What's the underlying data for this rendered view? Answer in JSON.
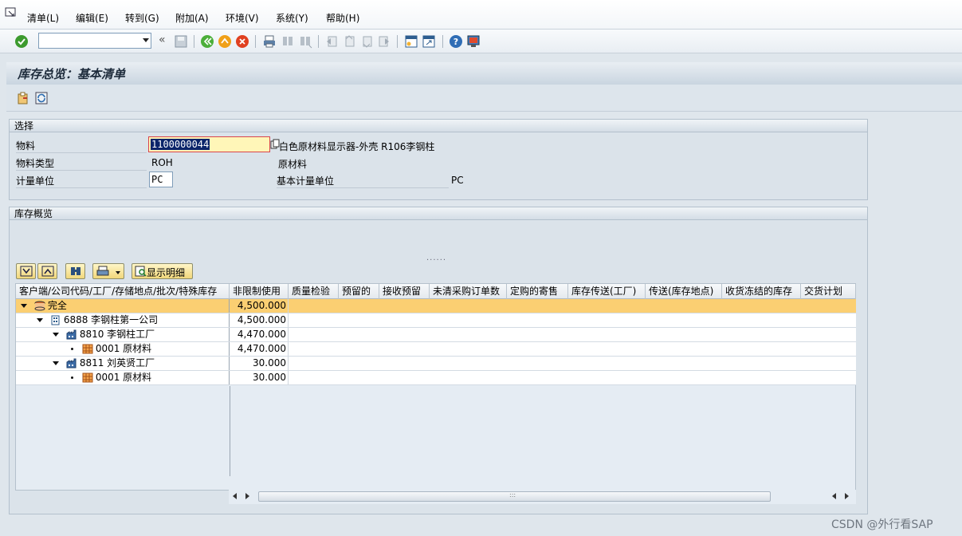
{
  "menu": {
    "items": [
      "清单(L)",
      "编辑(E)",
      "转到(G)",
      "附加(A)",
      "环境(V)",
      "系统(Y)",
      "帮助(H)"
    ]
  },
  "toolbar": {
    "command_field_value": "",
    "back_label": "«"
  },
  "page": {
    "title": "库存总览：基本清单"
  },
  "selection": {
    "group_title": "选择",
    "material_label": "物料",
    "material_value": "1100000044",
    "material_desc": "白色原材料显示器-外壳 R106李钢柱",
    "mattype_label": "物料类型",
    "mattype_value": "ROH",
    "mattype_desc": "原材料",
    "uom_label": "计量单位",
    "uom_value": "PC",
    "base_uom_label": "基本计量单位",
    "base_uom_value": "PC"
  },
  "overview": {
    "group_title": "库存概览",
    "splitter_dots": "......",
    "detail_button": "显示明细",
    "columns": [
      "客户端/公司代码/工厂/存储地点/批次/特殊库存",
      "非限制使用",
      "质量检验",
      "预留的",
      "接收预留",
      "未清采购订单数",
      "定购的寄售",
      "库存传送(工厂)",
      "传送(库存地点)",
      "收货冻结的库存",
      "交货计划"
    ],
    "rows": [
      {
        "label": "完全",
        "value": "4,500.000"
      },
      {
        "label": "6888 李钢柱第一公司",
        "value": "4,500.000"
      },
      {
        "label": "8810 李钢柱工厂",
        "value": "4,470.000"
      },
      {
        "label": "0001 原材料",
        "value": "4,470.000"
      },
      {
        "label": "8811 刘英贤工厂",
        "value": "30.000"
      },
      {
        "label": "0001 原材料",
        "value": "30.000"
      }
    ],
    "scroll_grip": ":::"
  },
  "watermark": "CSDN @外行看SAP",
  "colors": {
    "total_row": "#fbcf72",
    "background": "#dfe6ec",
    "focus_field": "#fff6b8"
  }
}
